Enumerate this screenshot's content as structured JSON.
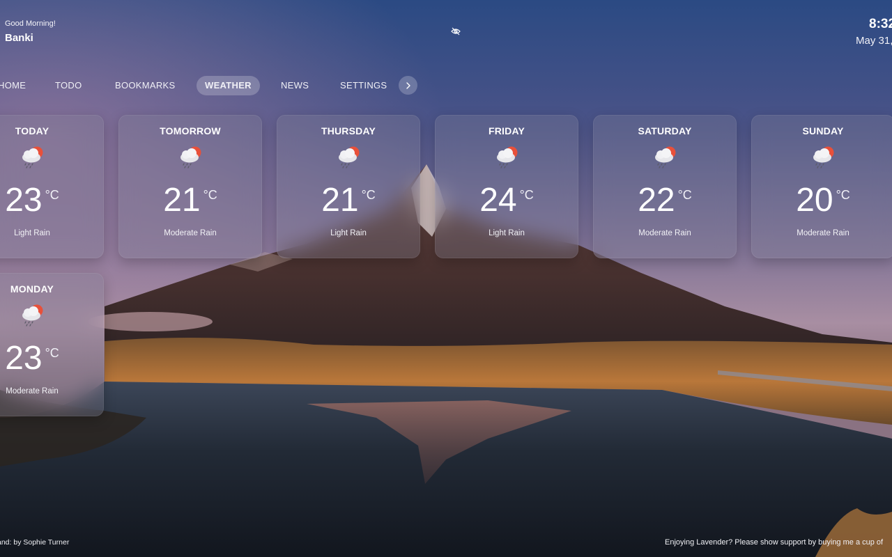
{
  "header": {
    "greeting": "Good Morning!",
    "username": "Banki",
    "time": "8:32",
    "date": "May 31,"
  },
  "nav": {
    "items": [
      {
        "label": "HOME"
      },
      {
        "label": "TODO"
      },
      {
        "label": "BOOKMARKS"
      },
      {
        "label": "WEATHER"
      },
      {
        "label": "NEWS"
      },
      {
        "label": "SETTINGS"
      }
    ],
    "active": "WEATHER"
  },
  "forecast": [
    {
      "day": "TODAY",
      "temp": "23",
      "unit": "°C",
      "condition": "Light Rain",
      "icon": "sun-cloud-rain-icon"
    },
    {
      "day": "TOMORROW",
      "temp": "21",
      "unit": "°C",
      "condition": "Moderate Rain",
      "icon": "sun-cloud-rain-icon"
    },
    {
      "day": "THURSDAY",
      "temp": "21",
      "unit": "°C",
      "condition": "Light Rain",
      "icon": "sun-cloud-rain-icon"
    },
    {
      "day": "FRIDAY",
      "temp": "24",
      "unit": "°C",
      "condition": "Light Rain",
      "icon": "sun-cloud-rain-icon"
    },
    {
      "day": "SATURDAY",
      "temp": "22",
      "unit": "°C",
      "condition": "Moderate Rain",
      "icon": "sun-cloud-rain-icon"
    },
    {
      "day": "SUNDAY",
      "temp": "20",
      "unit": "°C",
      "condition": "Moderate Rain",
      "icon": "sun-cloud-rain-icon"
    },
    {
      "day": "MONDAY",
      "temp": "23",
      "unit": "°C",
      "condition": "Moderate Rain",
      "icon": "sun-cloud-rain-icon"
    }
  ],
  "footer": {
    "photo_credit": "and: by Sophie Turner",
    "support_text": "Enjoying Lavender? Please show support by buying me a cup of"
  },
  "colors": {
    "sky_top": "#2d4a82",
    "sky_mid": "#5a5c8c",
    "horizon": "#a8889a",
    "water": "#1c2632",
    "grass": "#b9773a",
    "sun": "#e8503a"
  }
}
